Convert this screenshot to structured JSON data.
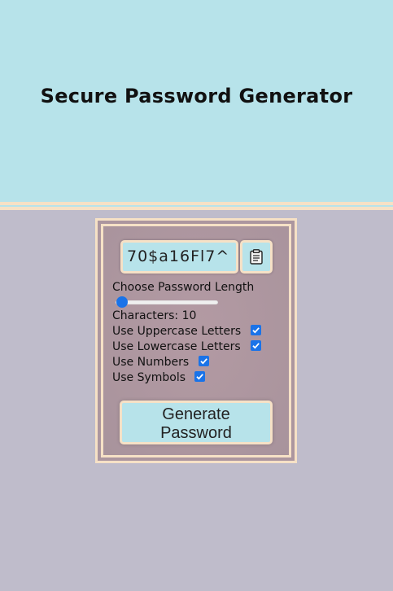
{
  "header": {
    "title": "Secure Password Generator"
  },
  "generator": {
    "password_value": "70$a16Fl7^",
    "copy_icon": "clipboard-icon",
    "length_label": "Choose Password Length",
    "length_value": 10,
    "characters_label": "Characters: 10",
    "options": [
      {
        "label": "Use Uppercase Letters",
        "checked": true
      },
      {
        "label": "Use Lowercase Letters",
        "checked": true
      },
      {
        "label": "Use Numbers",
        "checked": true
      },
      {
        "label": "Use Symbols",
        "checked": true
      }
    ],
    "generate_button": {
      "line1": "Generate",
      "line2": "Password"
    }
  },
  "colors": {
    "header_bg": "#b7e3ea",
    "page_bg": "#bfbccb",
    "card_bg": "#ac969f",
    "border_cream": "#f6e1c6",
    "accent_blue": "#1a73e8"
  }
}
